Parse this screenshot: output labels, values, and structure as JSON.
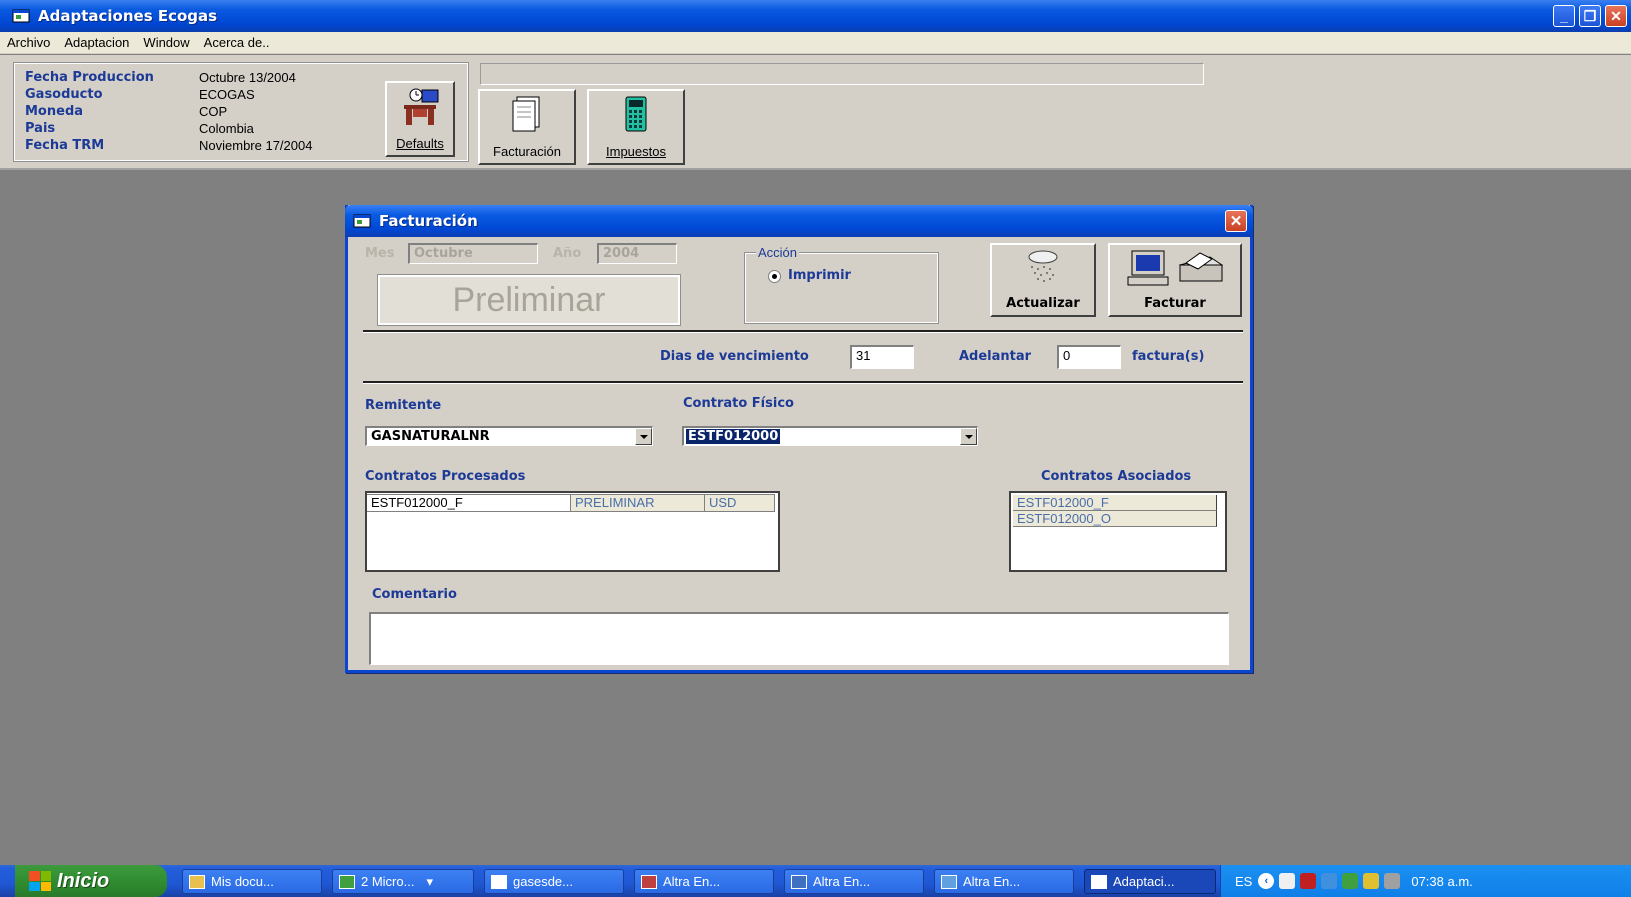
{
  "window": {
    "title": "Adaptaciones Ecogas"
  },
  "menu": [
    "Archivo",
    "Adaptacion",
    "Window",
    "Acerca de.."
  ],
  "info": [
    {
      "label": "Fecha Produccion",
      "value": "Octubre 13/2004"
    },
    {
      "label": "Gasoducto",
      "value": "ECOGAS"
    },
    {
      "label": "Moneda",
      "value": "COP"
    },
    {
      "label": "Pais",
      "value": "Colombia"
    },
    {
      "label": "Fecha TRM",
      "value": "Noviembre 17/2004"
    }
  ],
  "toolbar": {
    "defaults": "Defaults",
    "facturacion": "Facturación",
    "impuestos": "Impuestos"
  },
  "dialog": {
    "title": "Facturación",
    "mes_label": "Mes",
    "mes_value": "Octubre",
    "anio_label": "Año",
    "anio_value": "2004",
    "status": "Preliminar",
    "accion_legend": "Acción",
    "accion_option": "Imprimir",
    "actualizar": "Actualizar",
    "facturar": "Facturar",
    "dias_label": "Dias de vencimiento",
    "dias_value": "31",
    "adelantar_label": "Adelantar",
    "adelantar_value": "0",
    "facturas_label": "factura(s)",
    "remitente_label": "Remitente",
    "remitente_value": "GASNATURALNR",
    "contrato_label": "Contrato Físico",
    "contrato_value": "ESTF012000",
    "procesados_label": "Contratos Procesados",
    "procesados": [
      {
        "contrato": "ESTF012000_F",
        "estado": "PRELIMINAR",
        "moneda": "USD"
      }
    ],
    "asociados_label": "Contratos Asociados",
    "asociados": [
      "ESTF012000_F",
      "ESTF012000_O"
    ],
    "comentario_label": "Comentario",
    "comentario_value": ""
  },
  "taskbar": {
    "start": "Inicio",
    "items": [
      "Mis docu...",
      "2 Micro...",
      "gasesde...",
      "Altra En...",
      "Altra En...",
      "Altra En...",
      "Adaptaci..."
    ],
    "lang": "ES",
    "clock": "07:38 a.m."
  },
  "colors": {
    "titlebar": "#0a5ae0",
    "label_blue": "#1c3a96",
    "desktop": "#808080",
    "panel": "#d4d0c8"
  }
}
